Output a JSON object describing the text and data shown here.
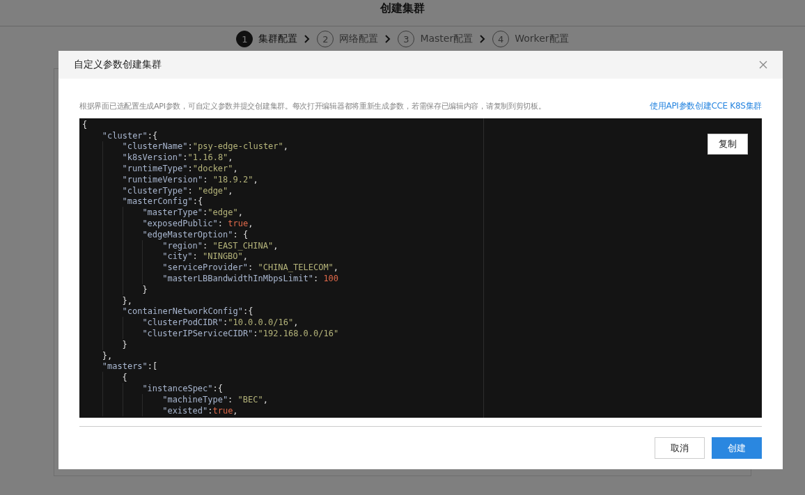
{
  "page": {
    "title": "创建集群",
    "steps": [
      {
        "number": "1",
        "label": "集群配置",
        "selected": true
      },
      {
        "number": "2",
        "label": "网络配置",
        "selected": false
      },
      {
        "number": "3",
        "label": "Master配置",
        "selected": false
      },
      {
        "number": "4",
        "label": "Worker配置",
        "selected": false
      }
    ]
  },
  "dialog": {
    "title": "自定义参数创建集群",
    "hint": "根据界面已选配置生成API参数，可自定义参数并提交创建集群。每次打开编辑器都将重新生成参数，若需保存已编辑内容，请复制到剪切板。",
    "link": "使用API参数创建CCE K8S集群",
    "copy_button": "复制",
    "code": [
      {
        "tokens": [
          {
            "kind": "punct",
            "text": "{"
          }
        ],
        "children": [
          {
            "tokens": [
              {
                "kind": "key",
                "text": "\"cluster\""
              },
              {
                "kind": "punct",
                "text": ":{"
              }
            ],
            "children": [
              {
                "tokens": [
                  {
                    "kind": "key",
                    "text": "\"clusterName\""
                  },
                  {
                    "kind": "punct",
                    "text": ":"
                  },
                  {
                    "kind": "str",
                    "text": "\"psy-edge-cluster\""
                  },
                  {
                    "kind": "punct",
                    "text": ","
                  }
                ]
              },
              {
                "tokens": [
                  {
                    "kind": "key",
                    "text": "\"k8sVersion\""
                  },
                  {
                    "kind": "punct",
                    "text": ":"
                  },
                  {
                    "kind": "str",
                    "text": "\"1.16.8\""
                  },
                  {
                    "kind": "punct",
                    "text": ","
                  }
                ]
              },
              {
                "tokens": [
                  {
                    "kind": "key",
                    "text": "\"runtimeType\""
                  },
                  {
                    "kind": "punct",
                    "text": ":"
                  },
                  {
                    "kind": "str",
                    "text": "\"docker\""
                  },
                  {
                    "kind": "punct",
                    "text": ","
                  }
                ]
              },
              {
                "tokens": [
                  {
                    "kind": "key",
                    "text": "\"runtimeVersion\""
                  },
                  {
                    "kind": "punct",
                    "text": ": "
                  },
                  {
                    "kind": "str",
                    "text": "\"18.9.2\""
                  },
                  {
                    "kind": "punct",
                    "text": ","
                  }
                ]
              },
              {
                "tokens": [
                  {
                    "kind": "key",
                    "text": "\"clusterType\""
                  },
                  {
                    "kind": "punct",
                    "text": ": "
                  },
                  {
                    "kind": "str",
                    "text": "\"edge\""
                  },
                  {
                    "kind": "punct",
                    "text": ","
                  }
                ]
              },
              {
                "tokens": [
                  {
                    "kind": "key",
                    "text": "\"masterConfig\""
                  },
                  {
                    "kind": "punct",
                    "text": ":{"
                  }
                ],
                "children": [
                  {
                    "tokens": [
                      {
                        "kind": "key",
                        "text": "\"masterType\""
                      },
                      {
                        "kind": "punct",
                        "text": ":"
                      },
                      {
                        "kind": "str",
                        "text": "\"edge\""
                      },
                      {
                        "kind": "punct",
                        "text": ","
                      }
                    ]
                  },
                  {
                    "tokens": [
                      {
                        "kind": "key",
                        "text": "\"exposedPublic\""
                      },
                      {
                        "kind": "punct",
                        "text": ": "
                      },
                      {
                        "kind": "literal",
                        "text": "true"
                      },
                      {
                        "kind": "punct",
                        "text": ","
                      }
                    ]
                  },
                  {
                    "tokens": [
                      {
                        "kind": "key",
                        "text": "\"edgeMasterOption\""
                      },
                      {
                        "kind": "punct",
                        "text": ": {"
                      }
                    ],
                    "children": [
                      {
                        "tokens": [
                          {
                            "kind": "key",
                            "text": "\"region\""
                          },
                          {
                            "kind": "punct",
                            "text": ": "
                          },
                          {
                            "kind": "str",
                            "text": "\"EAST_CHINA\""
                          },
                          {
                            "kind": "punct",
                            "text": ","
                          }
                        ]
                      },
                      {
                        "tokens": [
                          {
                            "kind": "key",
                            "text": "\"city\""
                          },
                          {
                            "kind": "punct",
                            "text": ": "
                          },
                          {
                            "kind": "str",
                            "text": "\"NINGBO\""
                          },
                          {
                            "kind": "punct",
                            "text": ","
                          }
                        ]
                      },
                      {
                        "tokens": [
                          {
                            "kind": "key",
                            "text": "\"serviceProvider\""
                          },
                          {
                            "kind": "punct",
                            "text": ": "
                          },
                          {
                            "kind": "str",
                            "text": "\"CHINA_TELECOM\""
                          },
                          {
                            "kind": "punct",
                            "text": ","
                          }
                        ]
                      },
                      {
                        "tokens": [
                          {
                            "kind": "key",
                            "text": "\"masterLBBandwidthInMbpsLimit\""
                          },
                          {
                            "kind": "punct",
                            "text": ": "
                          },
                          {
                            "kind": "literal",
                            "text": "100"
                          }
                        ]
                      }
                    ]
                  },
                  {
                    "tokens": [
                      {
                        "kind": "punct",
                        "text": "}"
                      }
                    ]
                  }
                ]
              },
              {
                "tokens": [
                  {
                    "kind": "punct",
                    "text": "},"
                  }
                ]
              },
              {
                "tokens": [
                  {
                    "kind": "key",
                    "text": "\"containerNetworkConfig\""
                  },
                  {
                    "kind": "punct",
                    "text": ":{"
                  }
                ],
                "children": [
                  {
                    "tokens": [
                      {
                        "kind": "key",
                        "text": "\"clusterPodCIDR\""
                      },
                      {
                        "kind": "punct",
                        "text": ":"
                      },
                      {
                        "kind": "str",
                        "text": "\"10.0.0.0/16\""
                      },
                      {
                        "kind": "punct",
                        "text": ","
                      }
                    ]
                  },
                  {
                    "tokens": [
                      {
                        "kind": "key",
                        "text": "\"clusterIPServiceCIDR\""
                      },
                      {
                        "kind": "punct",
                        "text": ":"
                      },
                      {
                        "kind": "str",
                        "text": "\"192.168.0.0/16\""
                      }
                    ]
                  }
                ]
              },
              {
                "tokens": [
                  {
                    "kind": "punct",
                    "text": "}"
                  }
                ]
              }
            ]
          },
          {
            "tokens": [
              {
                "kind": "punct",
                "text": "},"
              }
            ]
          },
          {
            "tokens": [
              {
                "kind": "key",
                "text": "\"masters\""
              },
              {
                "kind": "punct",
                "text": ":["
              }
            ],
            "children": [
              {
                "tokens": [
                  {
                    "kind": "punct",
                    "text": "{"
                  }
                ],
                "children": [
                  {
                    "tokens": [
                      {
                        "kind": "key",
                        "text": "\"instanceSpec\""
                      },
                      {
                        "kind": "punct",
                        "text": ":{"
                      }
                    ],
                    "children": [
                      {
                        "tokens": [
                          {
                            "kind": "key",
                            "text": "\"machineType\""
                          },
                          {
                            "kind": "punct",
                            "text": ": "
                          },
                          {
                            "kind": "str",
                            "text": "\"BEC\""
                          },
                          {
                            "kind": "punct",
                            "text": ","
                          }
                        ]
                      },
                      {
                        "tokens": [
                          {
                            "kind": "key",
                            "text": "\"existed\""
                          },
                          {
                            "kind": "punct",
                            "text": ":"
                          },
                          {
                            "kind": "literal",
                            "text": "true"
                          },
                          {
                            "kind": "punct",
                            "text": ","
                          }
                        ]
                      }
                    ]
                  }
                ]
              }
            ]
          }
        ]
      }
    ],
    "buttons": [
      {
        "kind": "secondary",
        "label": "取消"
      },
      {
        "kind": "primary",
        "label": "创建"
      }
    ]
  }
}
